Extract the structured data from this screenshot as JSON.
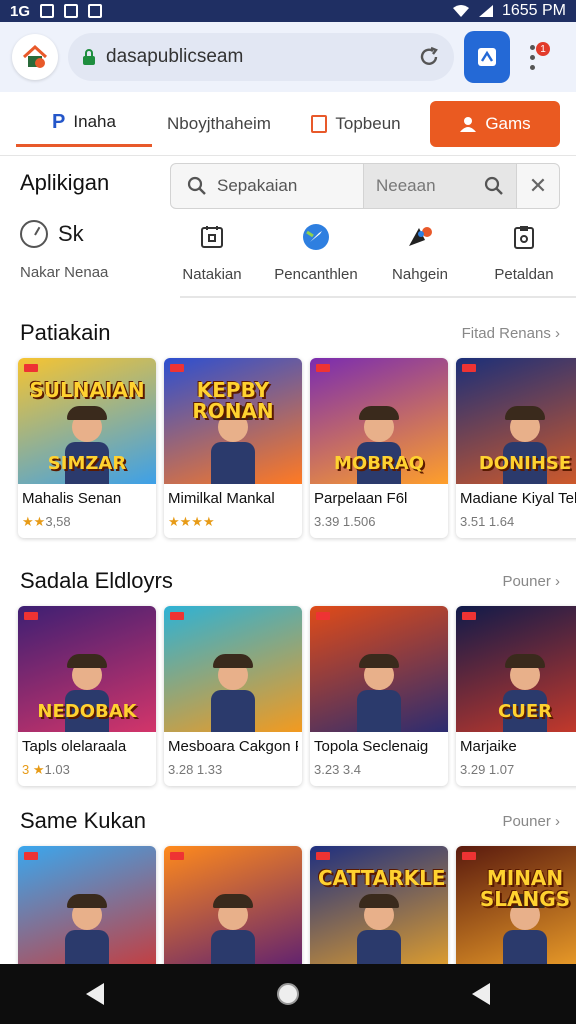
{
  "status_bar": {
    "left_text": "1G",
    "time": "1655 PM"
  },
  "browser": {
    "url": "dasapublicseam",
    "icons": {
      "logo": "house-logo-icon",
      "lock": "lock-icon",
      "refresh": "refresh-icon",
      "action": "apps-icon",
      "menu": "more-vertical-icon"
    },
    "menu_badge": "1"
  },
  "tabs": [
    {
      "label": "Inaha",
      "icon": "p-icon"
    },
    {
      "label": "Nboyjthaheim",
      "icon": ""
    },
    {
      "label": "Topbeun",
      "icon": "square-icon"
    },
    {
      "label": "Gams",
      "icon": "user-icon"
    }
  ],
  "apps": {
    "title": "Aplikigan",
    "search_placeholder": "Sepakaian",
    "search_secondary": "Neeaan",
    "sk_label": "Sk",
    "hint": "Nakar Nenaa",
    "categories": [
      {
        "label": "Natakian",
        "icon": "calendar-icon"
      },
      {
        "label": "Pencanthlen",
        "icon": "compass-icon"
      },
      {
        "label": "Nahgein",
        "icon": "game-icon"
      },
      {
        "label": "Petaldan",
        "icon": "clipboard-icon"
      }
    ]
  },
  "sections": [
    {
      "title": "Patiakain",
      "more": "Fitad Renans",
      "cards": [
        {
          "name": "Mahalis Senan",
          "rating": "3,58",
          "stars": "★★",
          "art_top": "SULNAIAN",
          "art_bottom": "SIMZAR",
          "colors": [
            "#f6c431",
            "#3da0e8"
          ]
        },
        {
          "name": "Mimilkal Mankal",
          "rating": "",
          "stars": "★★★★",
          "art_top": "KEPBY RONAN",
          "art_bottom": "",
          "colors": [
            "#2c4fd1",
            "#ff7a23"
          ]
        },
        {
          "name": "Parpelaan F6l",
          "rating": "3.39 1.506",
          "stars": "",
          "art_top": "",
          "art_bottom": "MOBRAQ",
          "colors": [
            "#7a2cb0",
            "#ff9f2a"
          ]
        },
        {
          "name": "Madiane Kiyal Tel",
          "rating": "3.51 1.64",
          "stars": "",
          "art_top": "",
          "art_bottom": "DONIHSE",
          "colors": [
            "#1b2f79",
            "#d45b28"
          ]
        }
      ]
    },
    {
      "title": "Sadala Eldloyrs",
      "more": "Pouner",
      "cards": [
        {
          "name": "Tapls olelaraala",
          "rating": "1.03",
          "stars": "3 ★",
          "art_top": "",
          "art_bottom": "NEDOBAK",
          "colors": [
            "#3d1f73",
            "#d3356a"
          ]
        },
        {
          "name": "Mesboara Cakgon Fala",
          "rating": "3.28 1.33",
          "stars": "",
          "art_top": "",
          "art_bottom": "",
          "colors": [
            "#2eb2d5",
            "#f39a1f"
          ]
        },
        {
          "name": "Topola Seclenaig",
          "rating": "3.23 3.4",
          "stars": "",
          "art_top": "",
          "art_bottom": "",
          "colors": [
            "#e04b18",
            "#2c2c70"
          ]
        },
        {
          "name": "Marjaike",
          "rating": "3.29 1.07",
          "stars": "",
          "art_top": "",
          "art_bottom": "CUER",
          "colors": [
            "#101a4a",
            "#c93a2a"
          ]
        }
      ]
    },
    {
      "title": "Same Kukan",
      "more": "Pouner",
      "cards": [
        {
          "name": "",
          "rating": "",
          "stars": "",
          "art_top": "",
          "art_bottom": "",
          "colors": [
            "#3aa7ee",
            "#c83b3b"
          ]
        },
        {
          "name": "",
          "rating": "",
          "stars": "",
          "art_top": "",
          "art_bottom": "",
          "colors": [
            "#ff8a1c",
            "#5c1f72"
          ]
        },
        {
          "name": "",
          "rating": "",
          "stars": "",
          "art_top": "CATTARKLE",
          "art_bottom": "",
          "colors": [
            "#1e2f80",
            "#e3a02c"
          ]
        },
        {
          "name": "",
          "rating": "",
          "stars": "",
          "art_top": "MINAN SLANGS",
          "art_bottom": "",
          "colors": [
            "#5a1a0e",
            "#f2a32a"
          ]
        }
      ]
    }
  ],
  "navbar": {
    "icons": [
      "back-icon",
      "home-icon",
      "recent-icon"
    ]
  },
  "colors": {
    "accent": "#ea5a21",
    "brand_blue": "#2469d6",
    "status_bar": "#1f2f63"
  }
}
